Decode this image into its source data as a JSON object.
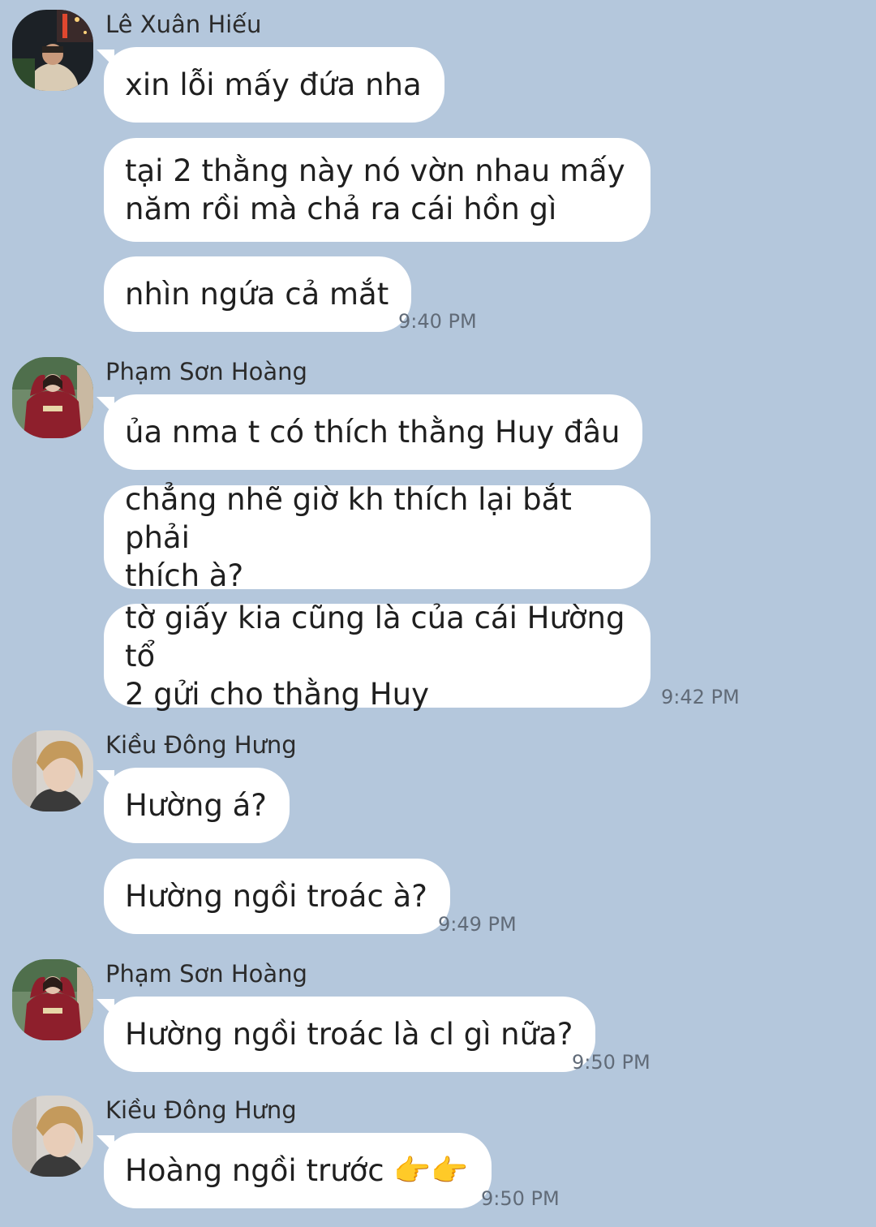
{
  "chat": {
    "groups": [
      {
        "sender": "Lê Xuân Hiếu",
        "avatar": "avatar-photo-night-city",
        "messages": [
          "xin lỗi mấy đứa nha",
          "tại 2 thằng này nó vờn nhau mấy\nnăm rồi mà chả ra cái hồn gì",
          "nhìn ngứa cả mắt"
        ],
        "time": "9:40 PM"
      },
      {
        "sender": "Phạm Sơn Hoàng",
        "avatar": "avatar-photo-red-sweater",
        "messages": [
          "ủa nma t có thích thằng Huy đâu",
          "chẳng nhẽ giờ kh thích lại bắt phải\nthích à?",
          "tờ giấy kia cũng là của cái Hường tổ\n2 gửi cho thằng Huy"
        ],
        "time": "9:42 PM"
      },
      {
        "sender": "Kiều Đông Hưng",
        "avatar": "avatar-photo-blond-hair",
        "messages": [
          "Hường á?",
          "Hường ngồi troác à?"
        ],
        "time": "9:49 PM"
      },
      {
        "sender": "Phạm Sơn Hoàng",
        "avatar": "avatar-photo-red-sweater",
        "messages": [
          "Hường ngồi troác là cl gì nữa?"
        ],
        "time": "9:50 PM"
      },
      {
        "sender": "Kiều Đông Hưng",
        "avatar": "avatar-photo-blond-hair",
        "messages": [
          "Hoàng ngồi trước 👉👉"
        ],
        "time": "9:50 PM"
      }
    ]
  },
  "colors": {
    "background": "#b4c7dc",
    "bubble": "#ffffff",
    "timestamp": "#616b78"
  }
}
